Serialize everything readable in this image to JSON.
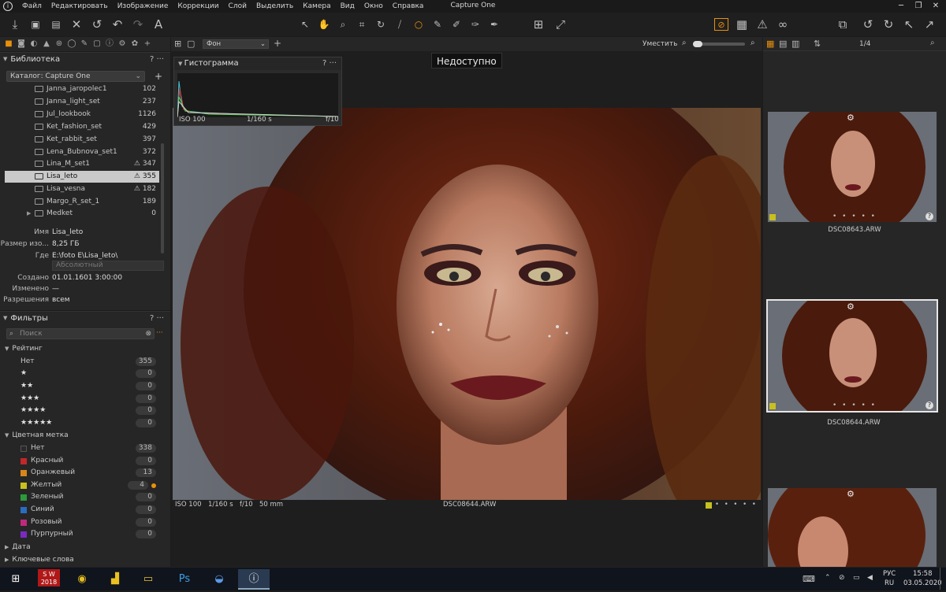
{
  "menubar": {
    "items": [
      "Файл",
      "Редактировать",
      "Изображение",
      "Коррекции",
      "Слой",
      "Выделить",
      "Камера",
      "Вид",
      "Окно",
      "Справка"
    ],
    "title": "Capture One"
  },
  "library": {
    "title": "Библиотека",
    "catalog": "Каталог: Capture One",
    "albums": [
      {
        "name": "Janna_jaropolec1",
        "count": "102"
      },
      {
        "name": "Janna_light_set",
        "count": "237"
      },
      {
        "name": "Jul_lookbook",
        "count": "1126"
      },
      {
        "name": "Ket_fashion_set",
        "count": "429"
      },
      {
        "name": "Ket_rabbit_set",
        "count": "397"
      },
      {
        "name": "Lena_Bubnova_set1",
        "count": "372"
      },
      {
        "name": "Lina_M_set1",
        "count": "347"
      },
      {
        "name": "Lisa_leto",
        "count": "355"
      },
      {
        "name": "Lisa_vesna",
        "count": "182"
      },
      {
        "name": "Margo_R_set_1",
        "count": "189"
      },
      {
        "name": "Medket",
        "count": "0"
      }
    ],
    "props": {
      "name_k": "Имя",
      "name_v": "Lisa_leto",
      "size_k": "Размер изо...",
      "size_v": "8,25 ГБ",
      "where_k": "Где",
      "where_v": "E:\\foto E\\Lisa_leto\\",
      "path_mode": "Абсолютный",
      "created_k": "Создано",
      "created_v": "01.01.1601 3:00:00",
      "changed_k": "Изменено",
      "changed_v": "—",
      "perm_k": "Разрешения",
      "perm_v": "всем"
    }
  },
  "filters": {
    "title": "Фильтры",
    "search_placeholder": "Поиск",
    "rating_title": "Рейтинг",
    "ratings": [
      {
        "label": "Нет",
        "count": "355"
      },
      {
        "label": "★",
        "count": "0"
      },
      {
        "label": "★★",
        "count": "0"
      },
      {
        "label": "★★★",
        "count": "0"
      },
      {
        "label": "★★★★",
        "count": "0"
      },
      {
        "label": "★★★★★",
        "count": "0"
      }
    ],
    "color_title": "Цветная метка",
    "colors": [
      {
        "label": "Нет",
        "count": "338",
        "color": "#2a2a2a"
      },
      {
        "label": "Красный",
        "count": "0",
        "color": "#c0282a"
      },
      {
        "label": "Оранжевый",
        "count": "13",
        "color": "#d8861c"
      },
      {
        "label": "Желтый",
        "count": "4",
        "color": "#c8c01e"
      },
      {
        "label": "Зеленый",
        "count": "0",
        "color": "#2a9a3a"
      },
      {
        "label": "Синий",
        "count": "0",
        "color": "#2a6cc0"
      },
      {
        "label": "Розовый",
        "count": "0",
        "color": "#c02a7a"
      },
      {
        "label": "Пурпурный",
        "count": "0",
        "color": "#7a2ac0"
      }
    ],
    "date_title": "Дата",
    "keywords_title": "Ключевые слова"
  },
  "viewer": {
    "layer_select": "Фон",
    "fit_label": "Уместить",
    "histogram_title": "Гистограмма",
    "iso": "ISO 100",
    "shutter": "1/160 s",
    "aperture": "f/10",
    "focal": "50 mm",
    "unavailable": "Недоступно",
    "filename": "DSC08644.ARW"
  },
  "browser": {
    "counter": "1/4",
    "thumbs": [
      "DSC08643.ARW",
      "DSC08644.ARW"
    ]
  },
  "taskbar": {
    "lang": "РУС",
    "lang2": "RU",
    "time": "15:58",
    "date": "03.05.2020",
    "sw_label": "2018"
  },
  "colors": {
    "accent": "#e8900c"
  }
}
